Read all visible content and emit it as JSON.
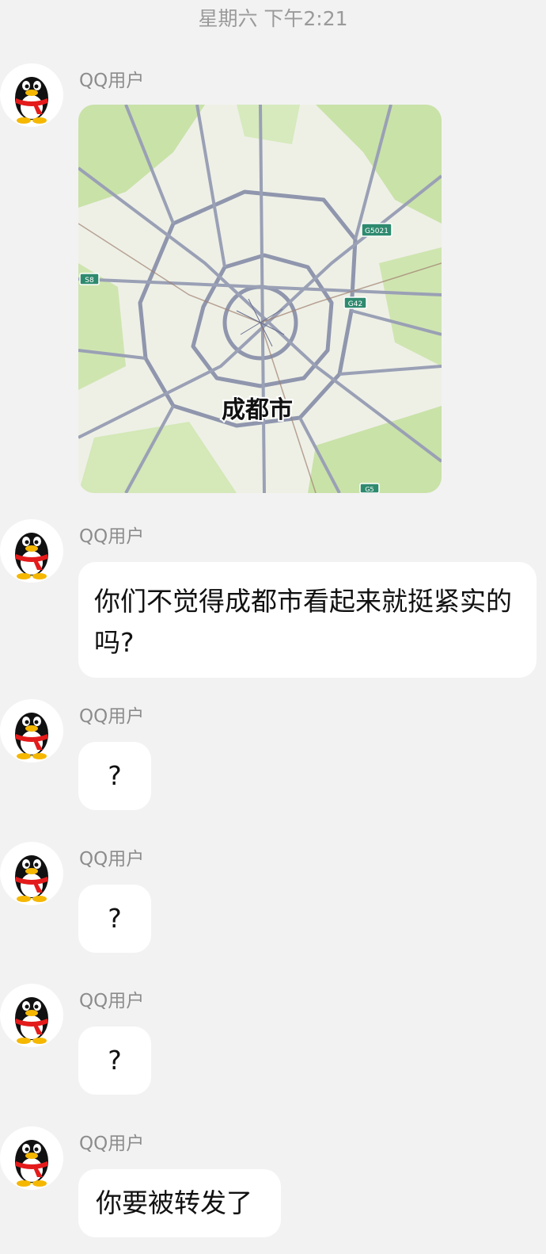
{
  "header": {
    "timestamp": "星期六 下午2:21"
  },
  "messages": [
    {
      "sender": "QQ用户",
      "type": "image",
      "map": {
        "city_label": "成都市",
        "shields": [
          "S8",
          "G5021",
          "G42",
          "G5"
        ]
      }
    },
    {
      "sender": "QQ用户",
      "type": "text",
      "text": "你们不觉得成都市看起来就挺紧实的吗?"
    },
    {
      "sender": "QQ用户",
      "type": "text",
      "text": "?"
    },
    {
      "sender": "QQ用户",
      "type": "text",
      "text": "?"
    },
    {
      "sender": "QQ用户",
      "type": "text",
      "text": "?"
    },
    {
      "sender": "QQ用户",
      "type": "text",
      "text": "你要被转发了"
    }
  ],
  "colors": {
    "background": "#f2f2f2",
    "bubble": "#ffffff",
    "map_road": "#8f96ad",
    "map_green": "#c9e2a8",
    "shield": "#2e8a6e"
  },
  "icons": {
    "avatar": "qq-penguin-icon"
  }
}
